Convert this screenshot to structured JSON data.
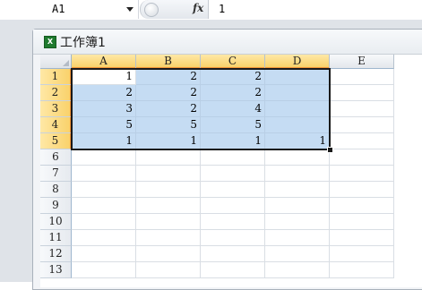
{
  "formula_bar": {
    "name_box": "A1",
    "fx": "fx",
    "value": "1"
  },
  "workbook": {
    "title": "工作簿1"
  },
  "sheet": {
    "columns": [
      "A",
      "B",
      "C",
      "D",
      "E"
    ],
    "rows": [
      "1",
      "2",
      "3",
      "4",
      "5",
      "6",
      "7",
      "8",
      "9",
      "10",
      "11",
      "12",
      "13"
    ],
    "cells": [
      [
        "1",
        "2",
        "2",
        "",
        ""
      ],
      [
        "2",
        "2",
        "2",
        "",
        ""
      ],
      [
        "3",
        "2",
        "4",
        "",
        ""
      ],
      [
        "5",
        "5",
        "5",
        "",
        ""
      ],
      [
        "1",
        "1",
        "1",
        "1",
        ""
      ],
      [
        "",
        "",
        "",
        "",
        ""
      ],
      [
        "",
        "",
        "",
        "",
        ""
      ],
      [
        "",
        "",
        "",
        "",
        ""
      ],
      [
        "",
        "",
        "",
        "",
        ""
      ],
      [
        "",
        "",
        "",
        "",
        ""
      ],
      [
        "",
        "",
        "",
        "",
        ""
      ],
      [
        "",
        "",
        "",
        "",
        ""
      ],
      [
        "",
        "",
        "",
        "",
        ""
      ]
    ],
    "selection": "A1:D5",
    "selection_color": "#c5dcf3",
    "header_highlight_color": "#f9d26b"
  }
}
